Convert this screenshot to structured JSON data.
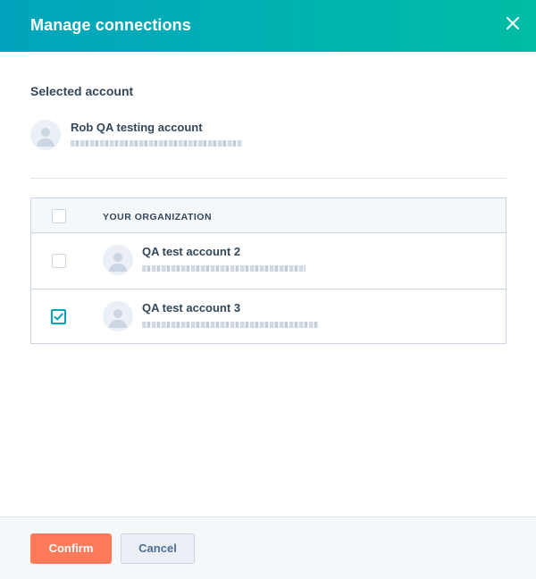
{
  "modal": {
    "title": "Manage connections"
  },
  "selected_account": {
    "section_title": "Selected account",
    "name": "Rob QA testing account"
  },
  "table": {
    "header": "YOUR ORGANIZATION",
    "rows": [
      {
        "name": "QA test account 2",
        "checked": false
      },
      {
        "name": "QA test account 3",
        "checked": true
      }
    ]
  },
  "footer": {
    "confirm_label": "Confirm",
    "cancel_label": "Cancel"
  },
  "colors": {
    "header_gradient_start": "#00a4bd",
    "header_gradient_end": "#00bda5",
    "confirm_button": "#ff7a59",
    "checkbox_checked": "#00a4bd",
    "text_primary": "#33475b"
  },
  "icons": {
    "close": "close-icon",
    "avatar": "user-avatar-icon",
    "check": "checkmark-icon"
  }
}
